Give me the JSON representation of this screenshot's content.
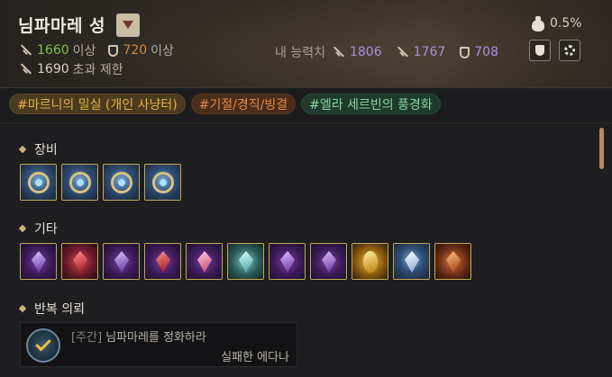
{
  "header": {
    "title": "님파마레 성",
    "requirements": {
      "attack": "1660",
      "attack_suffix": "이상",
      "defense": "720",
      "defense_suffix": "이상",
      "limit": "1690",
      "limit_suffix": "초과 제한"
    },
    "my_power": {
      "label": "내 능력치",
      "attack": "1806",
      "accuracy": "1767",
      "defense": "708"
    },
    "drop_rate": "0.5%"
  },
  "tags": [
    "#마르니의 밀실 (개인 사냥터)",
    "#기절/경직/빙결",
    "#엘라 세르빈의 풍경화"
  ],
  "sections": {
    "equipment": "장비",
    "misc": "기타",
    "quest": "반복 의뢰"
  },
  "equipment_items": [
    {
      "icon": "weapon-icon",
      "color": "#2f4d74"
    },
    {
      "icon": "helmet-icon",
      "color": "#2f4d74"
    },
    {
      "icon": "armor-icon",
      "color": "#2f4d74"
    },
    {
      "icon": "gloves-icon",
      "color": "#2f4d74"
    }
  ],
  "misc_items": [
    {
      "icon": "dark-crystal-icon"
    },
    {
      "icon": "red-crystal-icon"
    },
    {
      "icon": "purple-ore-icon"
    },
    {
      "icon": "crimson-crystal-icon"
    },
    {
      "icon": "pink-shard-icon"
    },
    {
      "icon": "white-shards-icon"
    },
    {
      "icon": "violet-gem-icon"
    },
    {
      "icon": "amethyst-icon"
    },
    {
      "icon": "gold-egg-icon"
    },
    {
      "icon": "potion-vial-icon"
    },
    {
      "icon": "orange-claw-icon"
    }
  ],
  "quest": {
    "kind": "[주간]",
    "title": "님파마레를 정화하라",
    "subtitle": "실패한 에다나"
  }
}
